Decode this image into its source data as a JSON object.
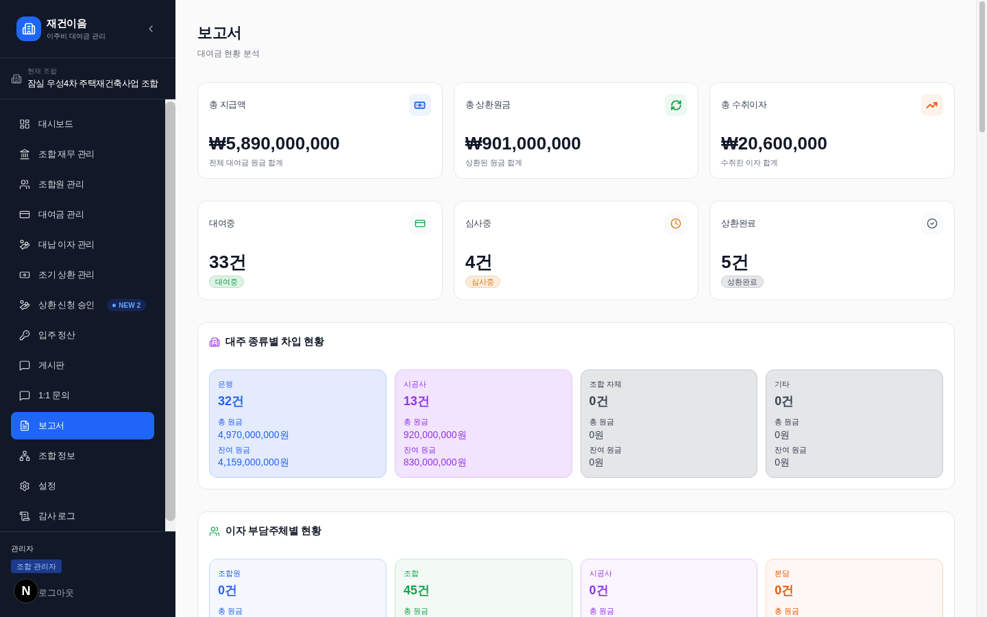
{
  "brand": {
    "name": "재건이음",
    "tagline": "이주비 대여금 관리"
  },
  "union": {
    "caption": "현재 조합",
    "name": "잠실 우성4차 주택재건축사업 조합"
  },
  "nav": [
    {
      "label": "대시보드",
      "selected": false
    },
    {
      "label": "조합 재무 관리",
      "selected": false
    },
    {
      "label": "조합원 관리",
      "selected": false
    },
    {
      "label": "대여금 관리",
      "selected": false
    },
    {
      "label": "대납 이자 관리",
      "selected": false
    },
    {
      "label": "조기 상환 관리",
      "selected": false
    },
    {
      "label": "상환 신청 승인",
      "selected": false,
      "badge": "NEW 2"
    },
    {
      "label": "입주 정산",
      "selected": false
    },
    {
      "label": "게시판",
      "selected": false
    },
    {
      "label": "1:1 문의",
      "selected": false
    },
    {
      "label": "보고서",
      "selected": true
    },
    {
      "label": "조합 정보",
      "selected": false
    },
    {
      "label": "설정",
      "selected": false
    },
    {
      "label": "감사 로그",
      "selected": false
    }
  ],
  "account": {
    "role": "관리자",
    "badge": "조합 관리자",
    "logout": "로그아웃"
  },
  "dev_indicator": "N",
  "page": {
    "title": "보고서",
    "subtitle": "대여금 현황 분석"
  },
  "summary_cards": [
    {
      "title": "총 지급액",
      "value": "₩5,890,000,000",
      "caption": "전체 대여금 원금 합계",
      "color": "#2563eb"
    },
    {
      "title": "총 상환원금",
      "value": "₩901,000,000",
      "caption": "상환된 원금 합계",
      "color": "#16a34a"
    },
    {
      "title": "총 수취이자",
      "value": "₩20,600,000",
      "caption": "수취한 이자 합계",
      "color": "#ea580c"
    }
  ],
  "status_cards": [
    {
      "title": "대여중",
      "value": "33건",
      "badge": "대여중",
      "color": "#16a34a"
    },
    {
      "title": "심사중",
      "value": "4건",
      "badge": "심사중",
      "color": "#d97706"
    },
    {
      "title": "상환완료",
      "value": "5건",
      "badge": "상환완료",
      "color": "#4b5563"
    }
  ],
  "lender_section": {
    "title": "대주 종류별 차입 현황",
    "groups": [
      {
        "label": "은행",
        "count": "32건",
        "total_label": "총 원금",
        "total": "4,970,000,000원",
        "remaining_label": "잔여 원금",
        "remaining": "4,159,000,000원",
        "color": "#2563eb"
      },
      {
        "label": "시공사",
        "count": "13건",
        "total_label": "총 원금",
        "total": "920,000,000원",
        "remaining_label": "잔여 원금",
        "remaining": "830,000,000원",
        "color": "#9333ea"
      },
      {
        "label": "조합 자체",
        "count": "0건",
        "total_label": "총 원금",
        "total": "0원",
        "remaining_label": "잔여 원금",
        "remaining": "0원",
        "color": "#374151"
      },
      {
        "label": "기타",
        "count": "0건",
        "total_label": "총 원금",
        "total": "0원",
        "remaining_label": "잔여 원금",
        "remaining": "0원",
        "color": "#374151"
      }
    ]
  },
  "interest_section": {
    "title": "이자 부담주체별 현황",
    "groups": [
      {
        "label": "조합원",
        "count": "0건",
        "total_label": "총 원금",
        "color": "#2563eb"
      },
      {
        "label": "조합",
        "count": "45건",
        "total_label": "총 원금",
        "color": "#16a34a"
      },
      {
        "label": "시공사",
        "count": "0건",
        "total_label": "총 원금",
        "color": "#9333ea"
      },
      {
        "label": "본담",
        "count": "0건",
        "total_label": "총 원금",
        "color": "#ea580c"
      }
    ]
  }
}
